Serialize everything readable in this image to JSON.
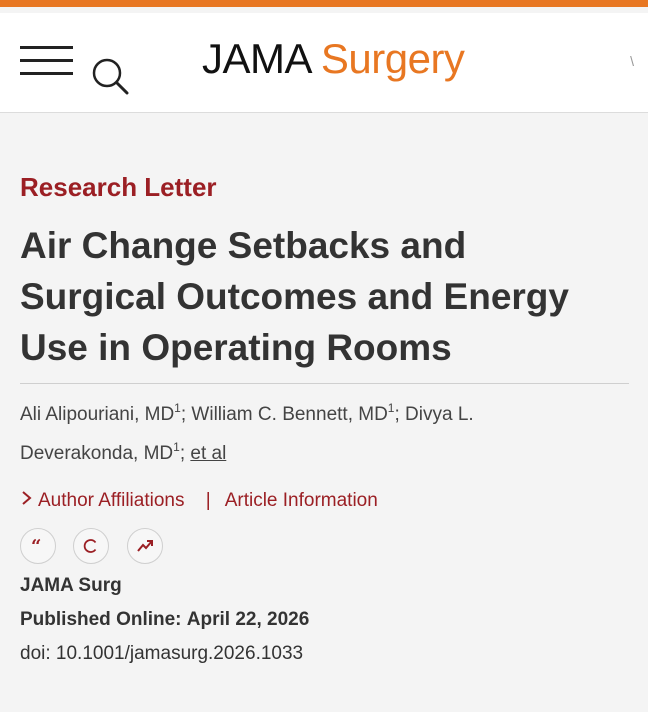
{
  "header": {
    "logo_primary": "JAMA",
    "logo_secondary": "Surgery",
    "menu_icon": "hamburger-menu-icon",
    "search_icon": "search-icon"
  },
  "article": {
    "type_label": "Research Letter",
    "title": "Air Change Setbacks and Surgical Outcomes and Energy Use in Operating Rooms",
    "authors": [
      {
        "name": "Ali Alipouriani, MD",
        "affil": "1"
      },
      {
        "name": "William C. Bennett, MD",
        "affil": "1"
      },
      {
        "name": "Divya L. Deverakonda, MD",
        "affil": "1"
      }
    ],
    "et_al": "et al",
    "author_affiliations_label": "Author Affiliations",
    "separator": "|",
    "article_information_label": "Article Information",
    "actions": [
      "quote-icon",
      "copyright-icon",
      "trending-chart-icon"
    ],
    "journal": "JAMA Surg",
    "published_label": "Published Online:",
    "published_date": "April 22, 2026",
    "doi_label": "doi:",
    "doi": "10.1001/jamasurg.2026.1033"
  },
  "colors": {
    "accent": "#e87722",
    "brand_red": "#9b1f24",
    "text": "#333333",
    "background": "#f4f4f4"
  }
}
